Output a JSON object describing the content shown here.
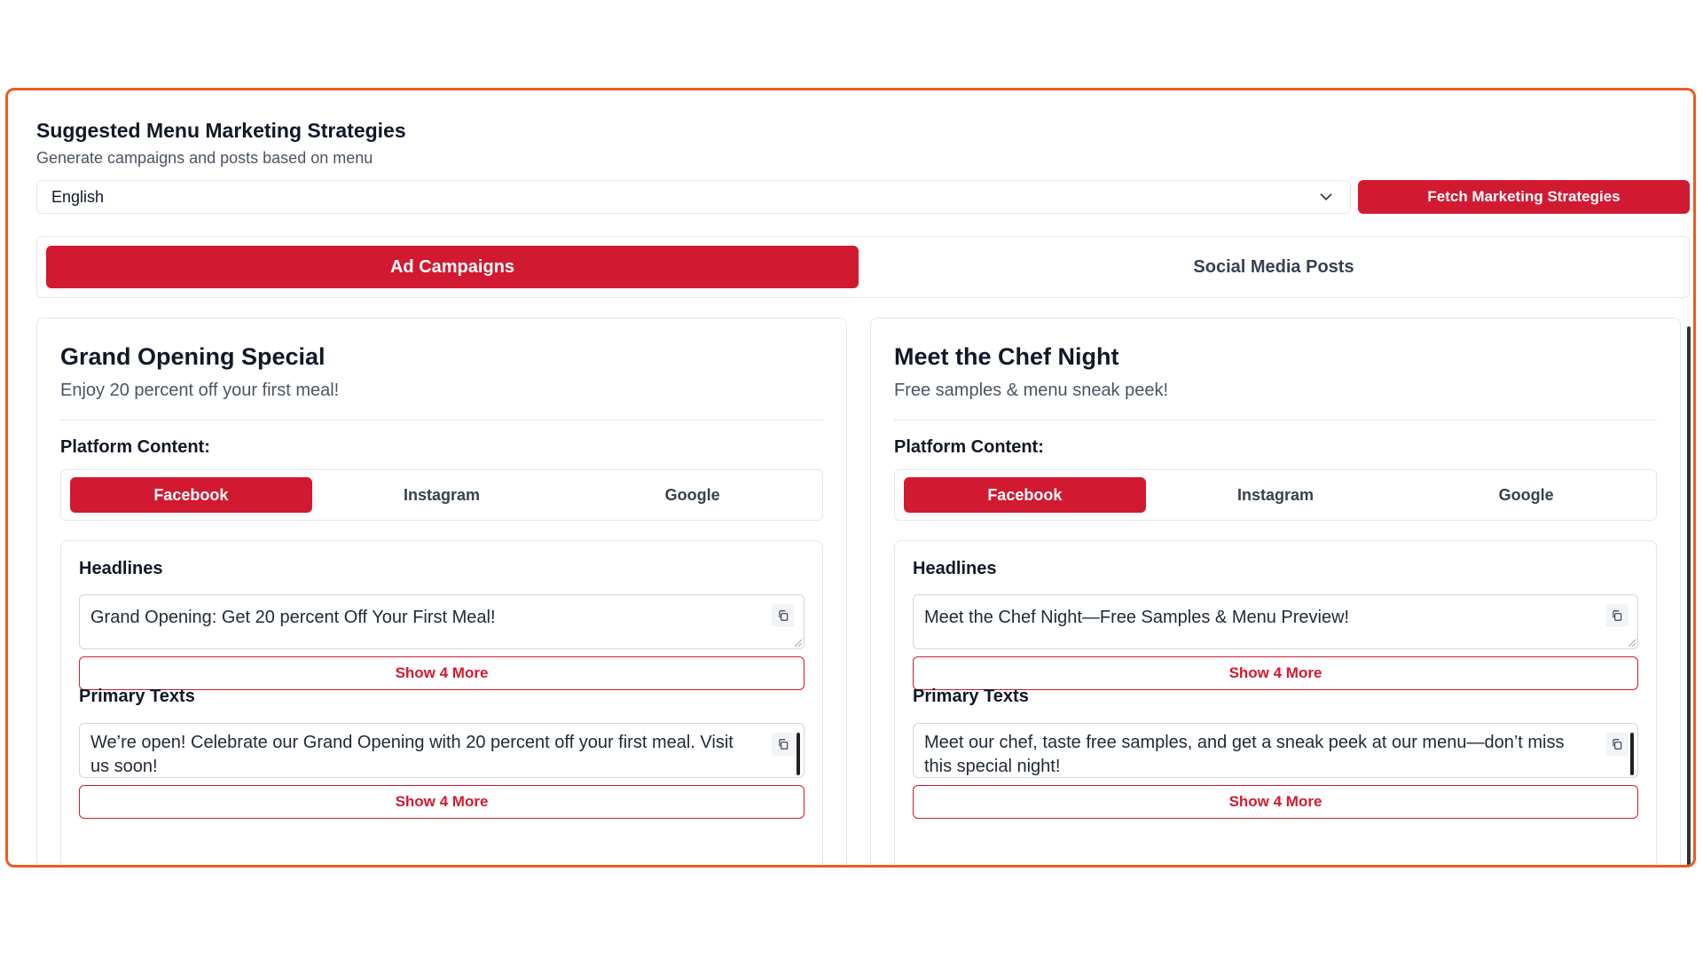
{
  "header": {
    "title": "Suggested Menu Marketing Strategies",
    "subtitle": "Generate campaigns and posts based on menu",
    "language_select": "English",
    "fetch_button": "Fetch Marketing Strategies"
  },
  "tabs": [
    {
      "label": "Ad Campaigns",
      "active": true
    },
    {
      "label": "Social Media Posts",
      "active": false
    }
  ],
  "cards": [
    {
      "title": "Grand Opening Special",
      "description": "Enjoy 20 percent off your first meal!",
      "platform_label": "Platform Content:",
      "platforms": [
        "Facebook",
        "Instagram",
        "Google"
      ],
      "active_platform": "Facebook",
      "headlines_label": "Headlines",
      "headline": "Grand Opening: Get 20 percent Off Your First Meal!",
      "headlines_more": "Show 4 More",
      "primary_label": "Primary Texts",
      "primary_text": "We’re open! Celebrate our Grand Opening with 20 percent off your first meal. Visit us soon!",
      "primary_more": "Show 4 More"
    },
    {
      "title": "Meet the Chef Night",
      "description": "Free samples & menu sneak peek!",
      "platform_label": "Platform Content:",
      "platforms": [
        "Facebook",
        "Instagram",
        "Google"
      ],
      "active_platform": "Facebook",
      "headlines_label": "Headlines",
      "headline": "Meet the Chef Night—Free Samples & Menu Preview!",
      "headlines_more": "Show 4 More",
      "primary_label": "Primary Texts",
      "primary_text": "Meet our chef, taste free samples, and get a sneak peek at our menu—don’t miss this special night!",
      "primary_more": "Show 4 More"
    }
  ],
  "colors": {
    "accent": "#d11a32",
    "frame_border": "#ee5a24"
  },
  "icons": {
    "select_chevron": "chevron-down-icon",
    "copy": "copy-icon"
  }
}
